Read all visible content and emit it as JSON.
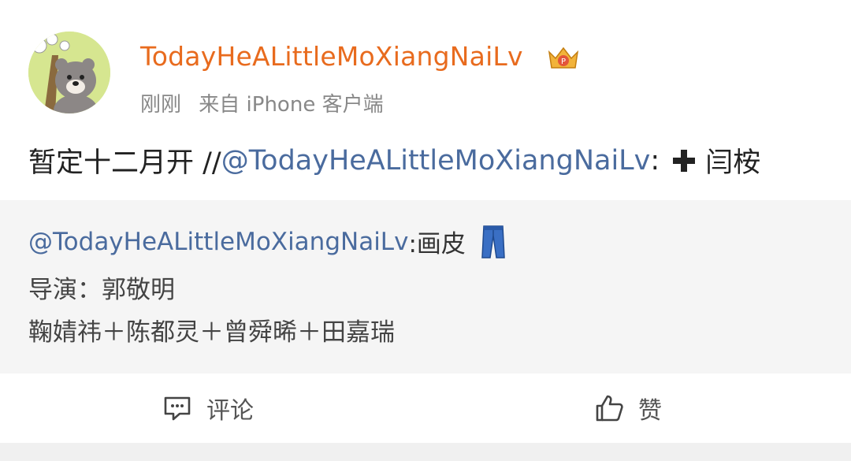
{
  "post": {
    "username": "TodayHeALittleMoXiangNaiLv",
    "time": "刚刚",
    "source": "来自 iPhone 客户端",
    "text_prefix": "暂定十二月开 //",
    "text_mention": "@TodayHeALittleMoXiangNaiLv",
    "text_colon": ":",
    "text_suffix": "闫桉",
    "plus_icon": "heavy-plus-icon",
    "badge_icon": "vip-crown-icon"
  },
  "repost": {
    "mention": "@TodayHeALittleMoXiangNaiLv",
    "line1_text": ":画皮",
    "line1_icon": "jeans-icon",
    "line2": "导演：郭敬明",
    "line3": "鞠婧祎＋陈都灵＋曾舜晞＋田嘉瑞"
  },
  "actions": {
    "comment_label": "评论",
    "like_label": "赞"
  },
  "colors": {
    "username": "#e86b1e",
    "mention": "#4a6b9e",
    "repost_bg": "#f5f5f5"
  }
}
